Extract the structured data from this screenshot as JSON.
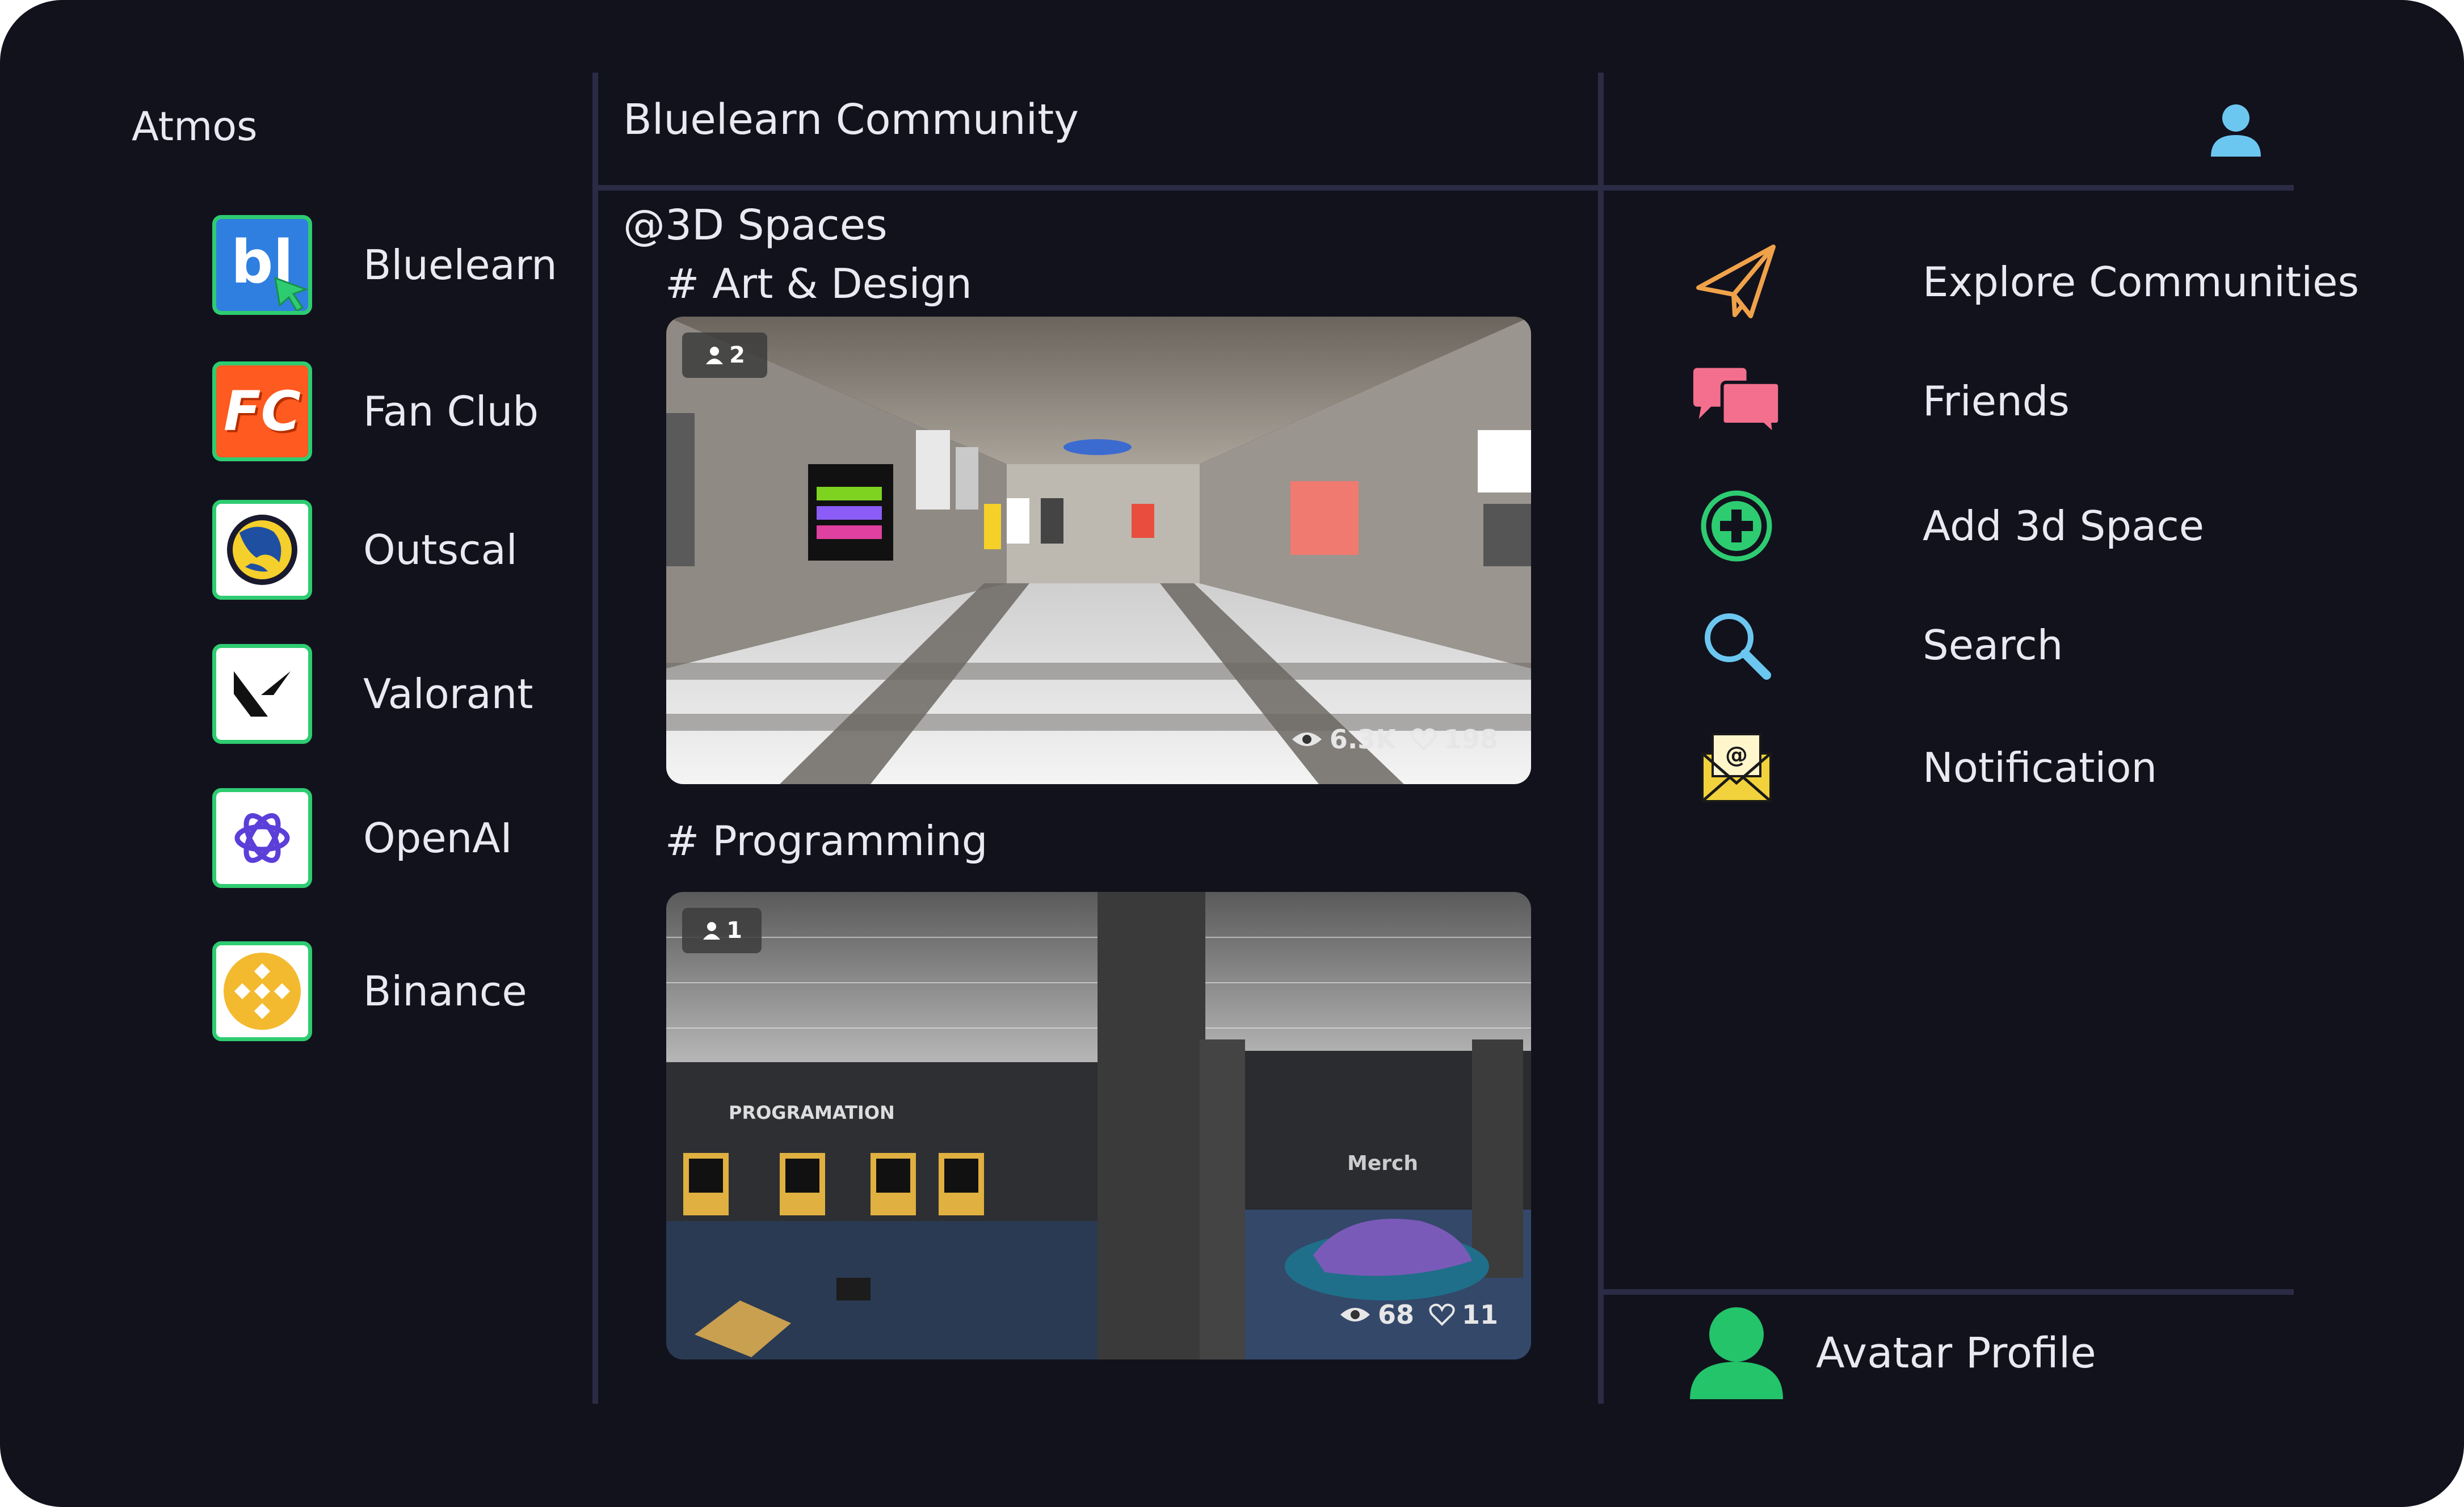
{
  "app": {
    "name": "Atmos"
  },
  "communities": [
    {
      "label": "Bluelearn",
      "logo_text": "bl"
    },
    {
      "label": "Fan Club",
      "logo_text": "FC"
    },
    {
      "label": "Outscal"
    },
    {
      "label": "Valorant"
    },
    {
      "label": "OpenAI"
    },
    {
      "label": "Binance"
    }
  ],
  "main": {
    "title": "Bluelearn Community",
    "section": "@3D Spaces",
    "spaces": [
      {
        "category": "# Art & Design",
        "users": "2",
        "views": "6.3K",
        "likes": "198"
      },
      {
        "category": "# Programming",
        "users": "1",
        "views": "68",
        "likes": "11",
        "scene_sign_1": "PROGRAMATION",
        "scene_sign_2": "Merch"
      }
    ]
  },
  "menu": [
    {
      "label": "Explore Communities",
      "icon": "paper-plane-icon",
      "color": "#f0a24a"
    },
    {
      "label": "Friends",
      "icon": "chat-bubbles-icon",
      "color": "#f46f8e"
    },
    {
      "label": "Add 3d Space",
      "icon": "plus-circle-icon",
      "color": "#2ecc71"
    },
    {
      "label": "Search",
      "icon": "search-icon",
      "color": "#6cc7f0"
    },
    {
      "label": "Notification",
      "icon": "mail-at-icon",
      "color": "#f2d23c"
    }
  ],
  "profile": {
    "label": "Avatar Profile",
    "avatar_color": "#23c46a",
    "user_icon_color": "#6cc7f0"
  }
}
